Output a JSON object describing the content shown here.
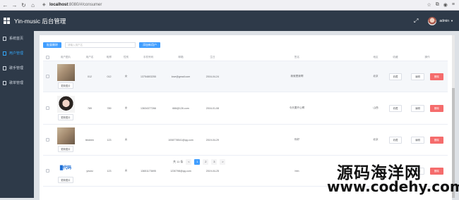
{
  "browser": {
    "url_host": "localhost",
    "url_path": ":8080/#/consumer"
  },
  "header": {
    "title": "Yin-music 后台管理",
    "user": "admin"
  },
  "sidebar": {
    "items": [
      {
        "label": "系统首页"
      },
      {
        "label": "用户管理"
      },
      {
        "label": "歌手管理"
      },
      {
        "label": "歌单管理"
      }
    ]
  },
  "toolbar": {
    "bulk_delete_label": "批量删除",
    "search_placeholder": "请输入用户名",
    "add_user_label": "添加新用户"
  },
  "table": {
    "headers": [
      "",
      "用户图片",
      "用户名",
      "昵称",
      "性别",
      "手机号码",
      "邮箱",
      "生日",
      "签名",
      "地区",
      "收藏",
      "操作"
    ],
    "update_photo_label": "更新图片",
    "collect_label": "收藏",
    "edit_label": "编辑",
    "delete_label": "删除",
    "rows": [
      {
        "username": "012",
        "nickname": "012",
        "gender": "女",
        "phone": "13754803255",
        "email": "love@gmail.com",
        "birthday": "2016-04-24",
        "signature": "我就是我啊",
        "region": "北京"
      },
      {
        "username": "789",
        "nickname": "789",
        "gender": "女",
        "phone": "13634377266",
        "email": "666@126.com",
        "birthday": "2016-01-08",
        "signature": "今天要开心啊",
        "region": "山西"
      },
      {
        "username": "tiecleen",
        "nickname": "123",
        "gender": "女",
        "phone": "",
        "email": "1008778541@qq.com",
        "birthday": "2019-04-29",
        "signature": "你好",
        "region": "北京"
      },
      {
        "username": "yiruisi",
        "nickname": "123",
        "gender": "女",
        "phone": "13651173695",
        "email": "1230798@qq.com",
        "birthday": "2019-04-25",
        "signature": "hhh",
        "region": "北京"
      }
    ]
  },
  "pagination": {
    "total_text": "共 11 条",
    "pages": [
      "1",
      "2",
      "3"
    ],
    "prev": "<",
    "next": ">"
  },
  "watermark": {
    "line1": "源码海洋网",
    "line2": "www.codehy.com"
  }
}
